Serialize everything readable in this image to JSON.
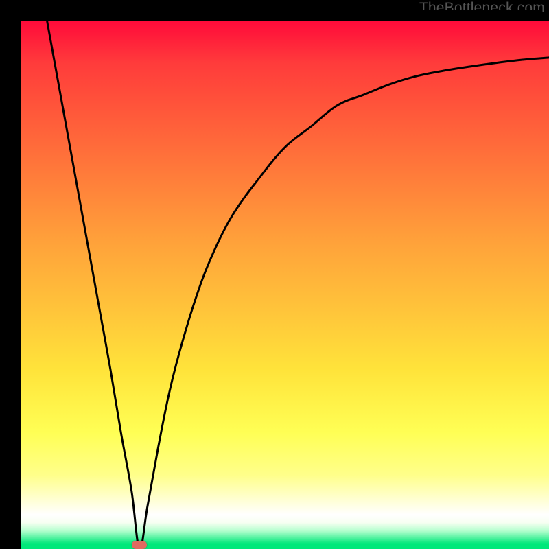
{
  "watermark": {
    "text": "TheBottleneck.com"
  },
  "chart_data": {
    "type": "line",
    "title": "",
    "xlabel": "",
    "ylabel": "",
    "xlim": [
      0,
      100
    ],
    "ylim": [
      0,
      100
    ],
    "background": "traffic-gradient-red-to-green",
    "marker": {
      "x": 22.5,
      "y": 0,
      "color": "#e06a60"
    },
    "series": [
      {
        "name": "bottleneck-curve",
        "x": [
          5,
          7,
          9,
          11,
          13,
          15,
          17,
          19,
          21,
          22.5,
          24,
          26,
          28,
          30,
          33,
          36,
          40,
          45,
          50,
          55,
          60,
          65,
          70,
          75,
          80,
          85,
          90,
          95,
          100
        ],
        "y": [
          100,
          89,
          78,
          67,
          56,
          45,
          34,
          22,
          11,
          0,
          8,
          19,
          29,
          37,
          47,
          55,
          63,
          70,
          76,
          80,
          84,
          86,
          88,
          89.5,
          90.5,
          91.3,
          92,
          92.6,
          93
        ]
      }
    ]
  },
  "colors": {
    "curve": "#000000",
    "marker": "#e06a60",
    "frame": "#000000"
  }
}
